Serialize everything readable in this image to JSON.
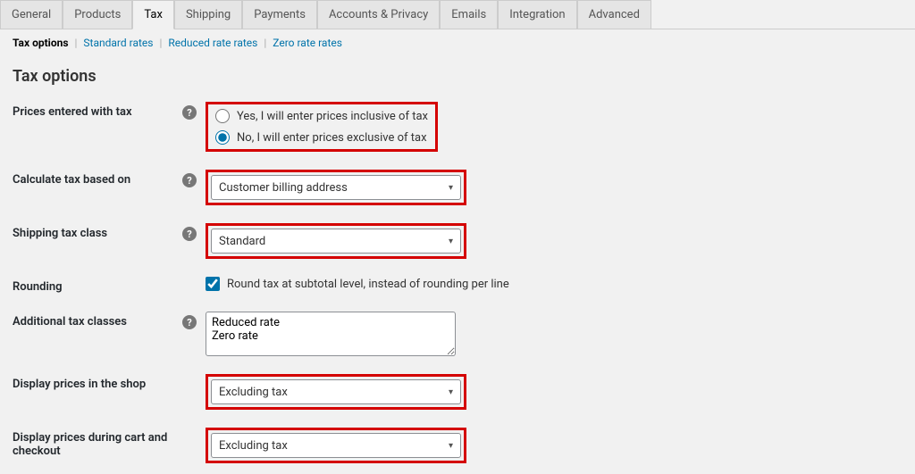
{
  "tabs": {
    "general": "General",
    "products": "Products",
    "tax": "Tax",
    "shipping": "Shipping",
    "payments": "Payments",
    "accounts": "Accounts & Privacy",
    "emails": "Emails",
    "integration": "Integration",
    "advanced": "Advanced"
  },
  "subtabs": {
    "options": "Tax options",
    "standard": "Standard rates",
    "reduced": "Reduced rate rates",
    "zero": "Zero rate rates"
  },
  "page_title": "Tax options",
  "fields": {
    "prices_with_tax": {
      "label": "Prices entered with tax",
      "option_yes": "Yes, I will enter prices inclusive of tax",
      "option_no": "No, I will enter prices exclusive of tax"
    },
    "calc_based_on": {
      "label": "Calculate tax based on",
      "value": "Customer billing address"
    },
    "shipping_tax_class": {
      "label": "Shipping tax class",
      "value": "Standard"
    },
    "rounding": {
      "label": "Rounding",
      "checkbox_label": "Round tax at subtotal level, instead of rounding per line"
    },
    "additional_classes": {
      "label": "Additional tax classes",
      "value": "Reduced rate\nZero rate"
    },
    "display_shop": {
      "label": "Display prices in the shop",
      "value": "Excluding tax"
    },
    "display_cart": {
      "label": "Display prices during cart and checkout",
      "value": "Excluding tax"
    }
  }
}
